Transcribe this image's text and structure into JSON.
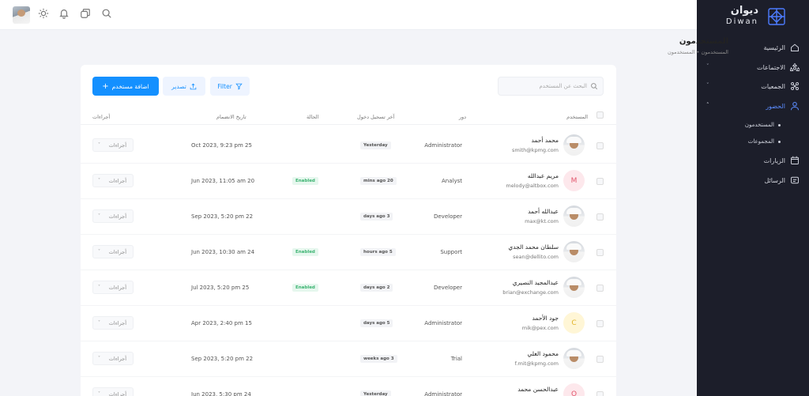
{
  "sidebar": {
    "logo_ar": "ديوان",
    "logo_en": "Diwan",
    "items": [
      {
        "label": "الرئيسية"
      },
      {
        "label": "الاجتماعات"
      },
      {
        "label": "الجمعيات"
      },
      {
        "label": "الحضور"
      },
      {
        "label": "الزيارات"
      },
      {
        "label": "الرسائل"
      }
    ],
    "subitems": [
      {
        "label": "المستخدمون"
      },
      {
        "label": "المجموعات"
      }
    ]
  },
  "header": {
    "title": "المستخدمون",
    "breadcrumb": "المستخدمون  •  المستخدمون"
  },
  "toolbar": {
    "search_placeholder": "البحث عن المستخدم",
    "add_label": "اضافة مستخدم",
    "export_label": "تصدير",
    "filter_label": "Filter"
  },
  "table": {
    "columns": {
      "user": "المستخدم",
      "role": "دور",
      "last_login": "آخر تسجيل دخول",
      "status": "الحالة",
      "joined": "تاريخ الانضمام",
      "actions": "أجراءات"
    },
    "rows": [
      {
        "name": "محمد أحمد",
        "email": "smith@kpmg.com",
        "role": "Administrator",
        "last_login": "Yesterday",
        "status": "",
        "joined": "Oct 2023, 9:23 pm 25",
        "avatar": "photo",
        "letter": "",
        "action": "أجراءات"
      },
      {
        "name": "مريم عبدالله",
        "email": "melody@altbox.com",
        "role": "Analyst",
        "last_login": "mins ago 20",
        "status": "Enabled",
        "joined": "Jun 2023, 11:05 am 20",
        "avatar": "letter",
        "letter": "M",
        "action": "أجراءات"
      },
      {
        "name": "عبدالله أحمد",
        "email": "max@kt.com",
        "role": "Developer",
        "last_login": "days ago 3",
        "status": "",
        "joined": "Sep 2023, 5:20 pm 22",
        "avatar": "photo",
        "letter": "",
        "action": "أجراءات"
      },
      {
        "name": "سلطان محمد الجدي",
        "email": "sean@dellito.com",
        "role": "Support",
        "last_login": "hours ago 5",
        "status": "Enabled",
        "joined": "Jun 2023, 10:30 am 24",
        "avatar": "photo",
        "letter": "",
        "action": "أجراءات"
      },
      {
        "name": "عبدالمجيد النصيري",
        "email": "brian@exchange.com",
        "role": "Developer",
        "last_login": "days ago 2",
        "status": "Enabled",
        "joined": "Jul 2023, 5:20 pm 25",
        "avatar": "photo",
        "letter": "",
        "action": "أجراءات"
      },
      {
        "name": "جود الأحمد",
        "email": "mik@pex.com",
        "role": "Administrator",
        "last_login": "days ago 5",
        "status": "",
        "joined": "Apr 2023, 2:40 pm 15",
        "avatar": "letter",
        "letter": "C",
        "action": "أجراءات"
      },
      {
        "name": "محمود الغلي",
        "email": "f.mit@kpmg.com",
        "role": "Trial",
        "last_login": "weeks ago 3",
        "status": "",
        "joined": "Sep 2023, 5:20 pm 22",
        "avatar": "photo",
        "letter": "",
        "action": "أجراءات"
      },
      {
        "name": "عبدالحسن محمد",
        "email": "",
        "role": "Administrator",
        "last_login": "Yesterday",
        "status": "",
        "joined": "Jun 2023, 5:30 pm 24",
        "avatar": "letter",
        "letter": "O",
        "action": "أجراءات"
      }
    ]
  },
  "colors": {
    "accent": "#1490ff",
    "sidebar_bg": "#1c1e2a",
    "enabled_text": "#3cb371",
    "enabled_bg": "#e6f7ee"
  }
}
